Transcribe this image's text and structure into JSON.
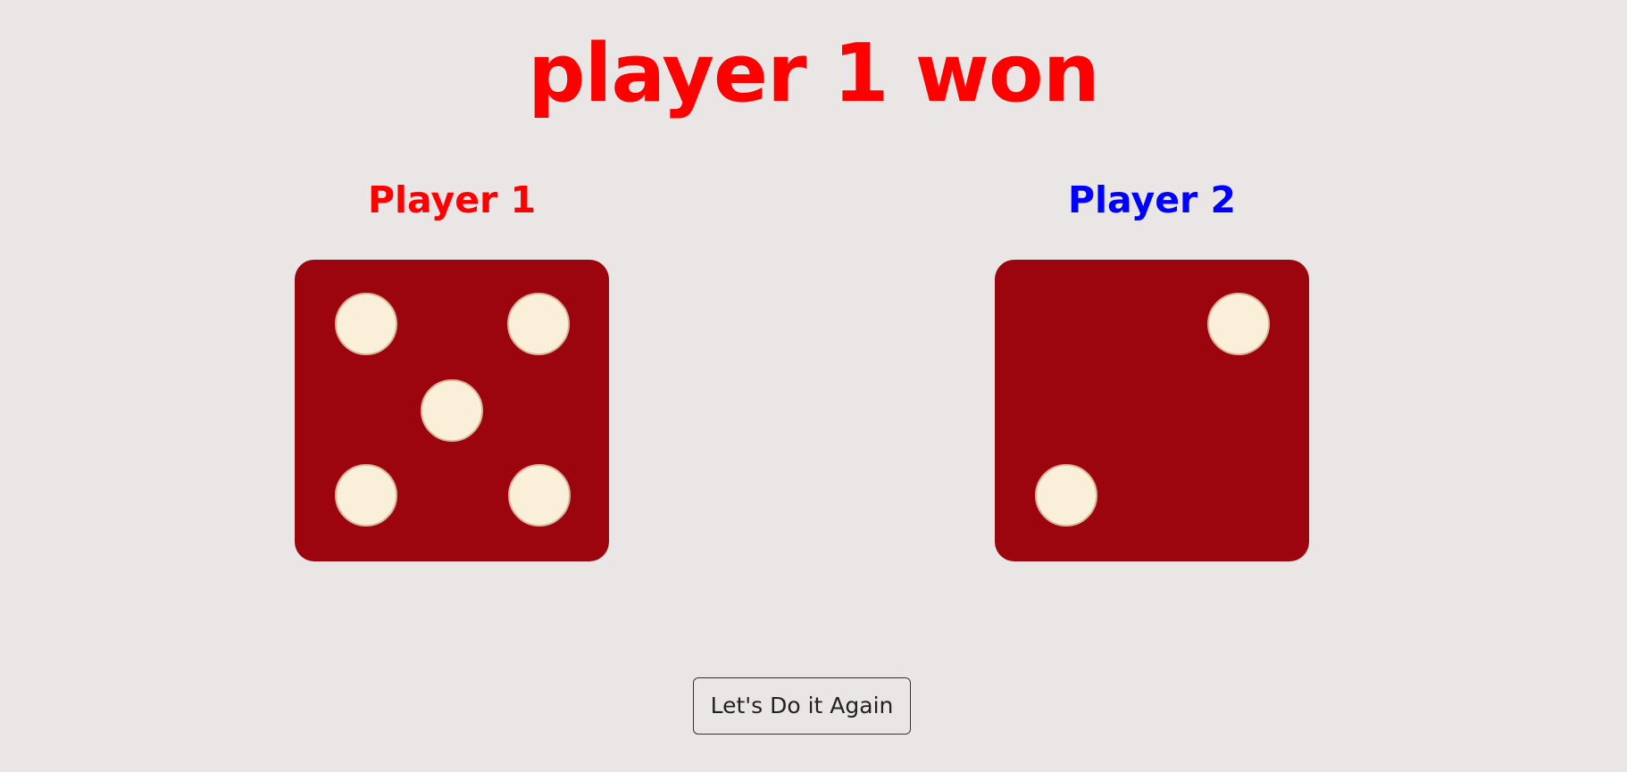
{
  "result": {
    "title": "player 1 won",
    "color": "#FF0000"
  },
  "players": [
    {
      "label": "Player 1",
      "color": "#FF0000",
      "die_value": 5
    },
    {
      "label": "Player 2",
      "color": "#0000FF",
      "die_value": 2
    }
  ],
  "dice_style": {
    "face_color": "#9C050E",
    "pip_color": "#FAF0D9"
  },
  "again_button": {
    "label": "Let's Do it Again"
  }
}
